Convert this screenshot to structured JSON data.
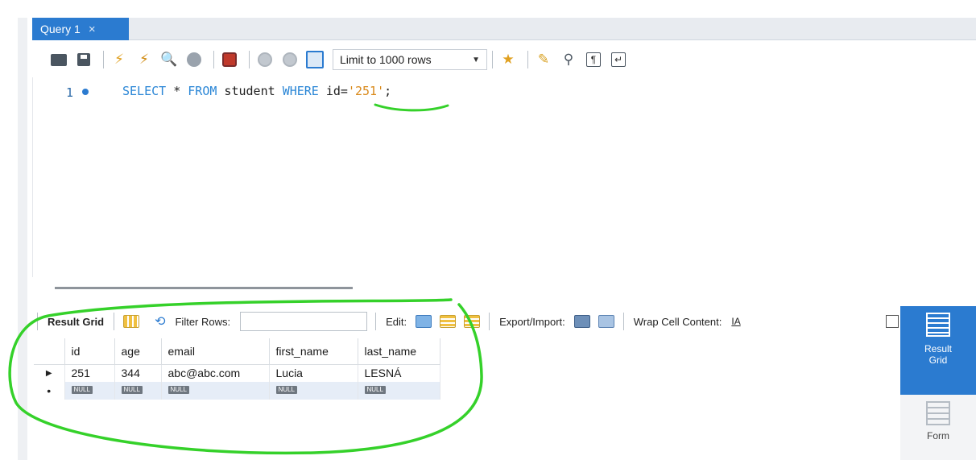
{
  "tab": {
    "title": "Query 1",
    "close": "×"
  },
  "toolbar": {
    "limit_label": "Limit to 1000 rows"
  },
  "editor": {
    "line_number": "1",
    "tokens": {
      "k1": "SELECT",
      "t1": " * ",
      "k2": "FROM",
      "t2": " student ",
      "k3": "WHERE",
      "t3": " id=",
      "s1": "'251'",
      "t4": ";"
    }
  },
  "result_toolbar": {
    "result_grid": "Result Grid",
    "filter_rows": "Filter Rows:",
    "edit": "Edit:",
    "export_import": "Export/Import:",
    "wrap": "Wrap Cell Content:"
  },
  "grid": {
    "columns": [
      "id",
      "age",
      "email",
      "first_name",
      "last_name"
    ],
    "row": [
      "251",
      "344",
      "abc@abc.com",
      "Lucia",
      "LESNÁ"
    ],
    "null_label": "NULL"
  },
  "side_panel": {
    "result_grid": "Result Grid",
    "form": "Form"
  },
  "colors": {
    "accent": "#2b7bd0",
    "highlight": "#35d12a"
  }
}
